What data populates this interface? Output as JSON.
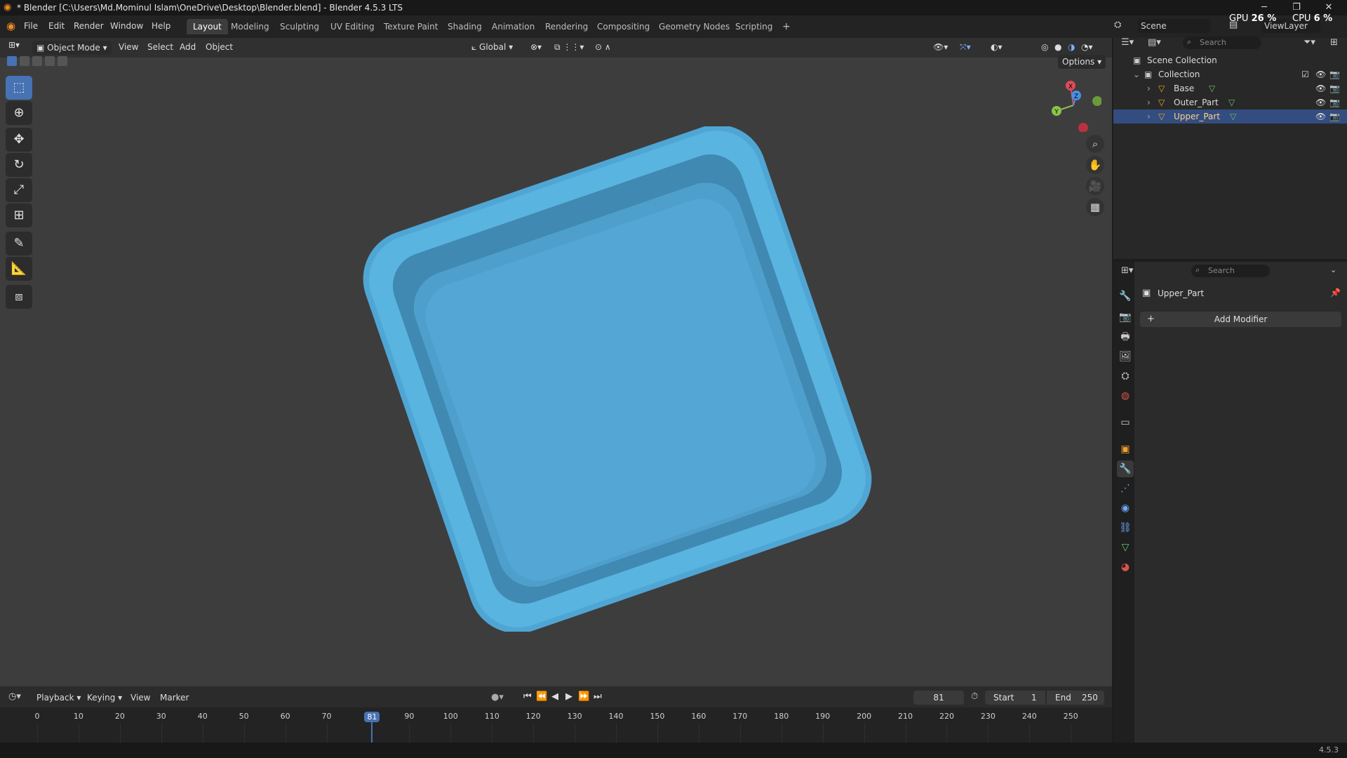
{
  "window": {
    "title": "* Blender [C:\\Users\\Md.Mominul Islam\\OneDrive\\Desktop\\Blender.blend] - Blender 4.5.3 LTS",
    "controls": [
      "─",
      "❐",
      "✕"
    ]
  },
  "menu": [
    "File",
    "Edit",
    "Render",
    "Window",
    "Help"
  ],
  "workspaces": [
    "Layout",
    "Modeling",
    "Sculpting",
    "UV Editing",
    "Texture Paint",
    "Shading",
    "Animation",
    "Rendering",
    "Compositing",
    "Geometry Nodes",
    "Scripting",
    "+"
  ],
  "active_workspace": "Layout",
  "scene": {
    "label": "Scene",
    "viewlayer": "ViewLayer"
  },
  "stats": {
    "gpu_label": "GPU",
    "gpu_value": "26 %",
    "cpu_label": "CPU",
    "cpu_value": "6 %"
  },
  "viewport_header": {
    "mode": "Object Mode",
    "menus": [
      "View",
      "Select",
      "Add",
      "Object"
    ],
    "orientation": "Global",
    "options": "Options"
  },
  "gizmo": {
    "x": "X",
    "y": "Y",
    "z": "Z"
  },
  "object_color": "#5ab4e0",
  "outliner": {
    "search_placeholder": "Search",
    "scene_collection": "Scene Collection",
    "collection": "Collection",
    "items": [
      "Base",
      "Outer_Part",
      "Upper_Part"
    ],
    "selected": "Upper_Part"
  },
  "properties": {
    "search_placeholder": "Search",
    "object_name": "Upper_Part",
    "add_modifier": "Add Modifier"
  },
  "timeline": {
    "menus": [
      "Playback",
      "Keying",
      "View",
      "Marker"
    ],
    "current_frame": "81",
    "start_label": "Start",
    "start": "1",
    "end_label": "End",
    "end": "250",
    "ticks": [
      "0",
      "10",
      "20",
      "30",
      "40",
      "50",
      "60",
      "70",
      "81",
      "90",
      "100",
      "110",
      "120",
      "130",
      "140",
      "150",
      "160",
      "170",
      "180",
      "190",
      "200",
      "210",
      "220",
      "230",
      "240",
      "250"
    ]
  },
  "status": {
    "version": "4.5.3"
  }
}
